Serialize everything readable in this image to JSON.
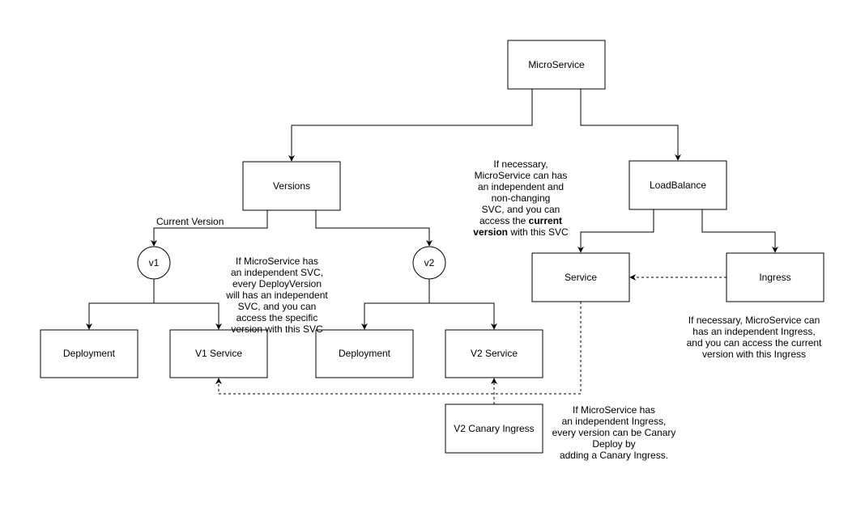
{
  "nodes": {
    "microservice": "MicroService",
    "versions": "Versions",
    "loadbalance": "LoadBalance",
    "v1": "v1",
    "v2": "v2",
    "deployment_v1": "Deployment",
    "v1_service": "V1 Service",
    "deployment_v2": "Deployment",
    "v2_service": "V2 Service",
    "service": "Service",
    "ingress": "Ingress",
    "v2_canary_ingress": "V2 Canary Ingress"
  },
  "edge_labels": {
    "current_version": "Current Version"
  },
  "notes": {
    "version_svc": [
      "If MicroService has",
      "an independent SVC,",
      "every DeployVersion",
      "will has an independent",
      "SVC, and you can",
      "access the specific",
      "version with this SVC"
    ],
    "loadbalance_svc": {
      "lines": [
        "If necessary,",
        "MicroService can has",
        "an independent and",
        "non-changing",
        "SVC, and you can"
      ],
      "line6_pre": "access the ",
      "line6_bold": "current",
      "line7_bold": "version",
      "line7_post": " with this SVC"
    },
    "ingress": [
      "If necessary, MicroService can",
      "has an independent Ingress,",
      "and you can access the current",
      "version with this Ingress"
    ],
    "canary": [
      "If MicroService has",
      "an independent Ingress,",
      "every version can be Canary",
      "Deploy by",
      "adding a Canary Ingress."
    ]
  }
}
